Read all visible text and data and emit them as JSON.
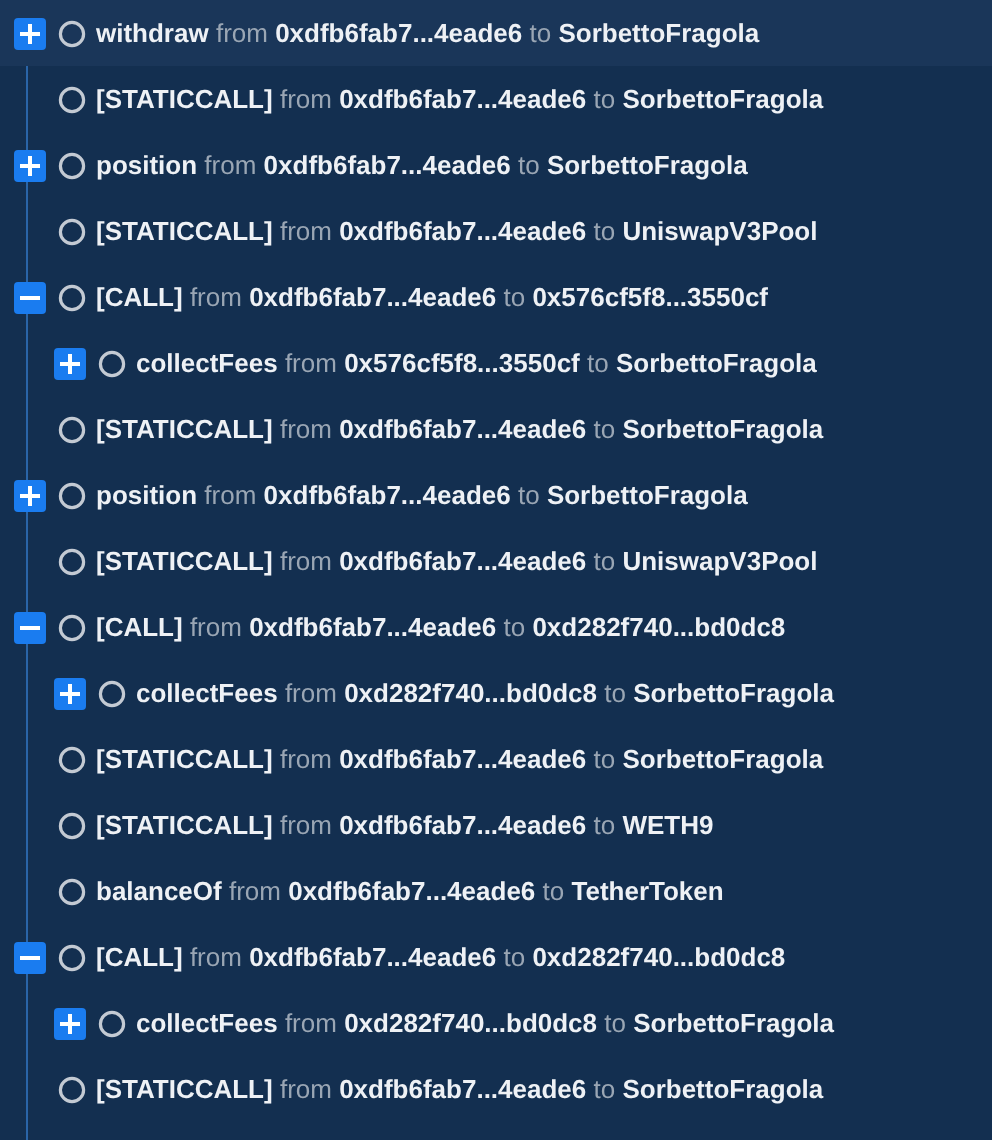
{
  "rows": [
    {
      "selected": true,
      "expanded": false,
      "parts": [
        {
          "kind": "strong",
          "text": "withdraw"
        },
        {
          "kind": "muted",
          "text": "from"
        },
        {
          "kind": "strong",
          "text": "0xdfb6fab7...4eade6"
        },
        {
          "kind": "muted",
          "text": "to"
        },
        {
          "kind": "strong",
          "text": "SorbettoFragola"
        }
      ]
    },
    {
      "selected": false,
      "parts": [
        {
          "kind": "strong",
          "text": "[STATICCALL]"
        },
        {
          "kind": "muted",
          "text": "from"
        },
        {
          "kind": "strong",
          "text": "0xdfb6fab7...4eade6"
        },
        {
          "kind": "muted",
          "text": "to"
        },
        {
          "kind": "strong",
          "text": "SorbettoFragola"
        }
      ]
    },
    {
      "selected": false,
      "expanded": false,
      "parts": [
        {
          "kind": "strong",
          "text": "position"
        },
        {
          "kind": "muted",
          "text": "from"
        },
        {
          "kind": "strong",
          "text": "0xdfb6fab7...4eade6"
        },
        {
          "kind": "muted",
          "text": "to"
        },
        {
          "kind": "strong",
          "text": "SorbettoFragola"
        }
      ]
    },
    {
      "selected": false,
      "parts": [
        {
          "kind": "strong",
          "text": "[STATICCALL]"
        },
        {
          "kind": "muted",
          "text": "from"
        },
        {
          "kind": "strong",
          "text": "0xdfb6fab7...4eade6"
        },
        {
          "kind": "muted",
          "text": "to"
        },
        {
          "kind": "strong",
          "text": "UniswapV3Pool"
        }
      ]
    },
    {
      "selected": false,
      "expanded": true,
      "parts": [
        {
          "kind": "strong",
          "text": "[CALL]"
        },
        {
          "kind": "muted",
          "text": "from"
        },
        {
          "kind": "strong",
          "text": "0xdfb6fab7...4eade6"
        },
        {
          "kind": "muted",
          "text": "to"
        },
        {
          "kind": "strong",
          "text": "0x576cf5f8...3550cf"
        }
      ],
      "children": [
        {
          "selected": false,
          "expanded": false,
          "parts": [
            {
              "kind": "strong",
              "text": "collectFees"
            },
            {
              "kind": "muted",
              "text": "from"
            },
            {
              "kind": "strong",
              "text": "0x576cf5f8...3550cf"
            },
            {
              "kind": "muted",
              "text": "to"
            },
            {
              "kind": "strong",
              "text": "SorbettoFragola"
            }
          ]
        }
      ]
    },
    {
      "selected": false,
      "parts": [
        {
          "kind": "strong",
          "text": "[STATICCALL]"
        },
        {
          "kind": "muted",
          "text": "from"
        },
        {
          "kind": "strong",
          "text": "0xdfb6fab7...4eade6"
        },
        {
          "kind": "muted",
          "text": "to"
        },
        {
          "kind": "strong",
          "text": "SorbettoFragola"
        }
      ]
    },
    {
      "selected": false,
      "expanded": false,
      "parts": [
        {
          "kind": "strong",
          "text": "position"
        },
        {
          "kind": "muted",
          "text": "from"
        },
        {
          "kind": "strong",
          "text": "0xdfb6fab7...4eade6"
        },
        {
          "kind": "muted",
          "text": "to"
        },
        {
          "kind": "strong",
          "text": "SorbettoFragola"
        }
      ]
    },
    {
      "selected": false,
      "parts": [
        {
          "kind": "strong",
          "text": "[STATICCALL]"
        },
        {
          "kind": "muted",
          "text": "from"
        },
        {
          "kind": "strong",
          "text": "0xdfb6fab7...4eade6"
        },
        {
          "kind": "muted",
          "text": "to"
        },
        {
          "kind": "strong",
          "text": "UniswapV3Pool"
        }
      ]
    },
    {
      "selected": false,
      "expanded": true,
      "parts": [
        {
          "kind": "strong",
          "text": "[CALL]"
        },
        {
          "kind": "muted",
          "text": "from"
        },
        {
          "kind": "strong",
          "text": "0xdfb6fab7...4eade6"
        },
        {
          "kind": "muted",
          "text": "to"
        },
        {
          "kind": "strong",
          "text": "0xd282f740...bd0dc8"
        }
      ],
      "children": [
        {
          "selected": false,
          "expanded": false,
          "parts": [
            {
              "kind": "strong",
              "text": "collectFees"
            },
            {
              "kind": "muted",
              "text": "from"
            },
            {
              "kind": "strong",
              "text": "0xd282f740...bd0dc8"
            },
            {
              "kind": "muted",
              "text": "to"
            },
            {
              "kind": "strong",
              "text": "SorbettoFragola"
            }
          ]
        }
      ]
    },
    {
      "selected": false,
      "parts": [
        {
          "kind": "strong",
          "text": "[STATICCALL]"
        },
        {
          "kind": "muted",
          "text": "from"
        },
        {
          "kind": "strong",
          "text": "0xdfb6fab7...4eade6"
        },
        {
          "kind": "muted",
          "text": "to"
        },
        {
          "kind": "strong",
          "text": "SorbettoFragola"
        }
      ]
    },
    {
      "selected": false,
      "parts": [
        {
          "kind": "strong",
          "text": "[STATICCALL]"
        },
        {
          "kind": "muted",
          "text": "from"
        },
        {
          "kind": "strong",
          "text": "0xdfb6fab7...4eade6"
        },
        {
          "kind": "muted",
          "text": "to"
        },
        {
          "kind": "strong",
          "text": "WETH9"
        }
      ]
    },
    {
      "selected": false,
      "parts": [
        {
          "kind": "strong",
          "text": "balanceOf"
        },
        {
          "kind": "muted",
          "text": "from"
        },
        {
          "kind": "strong",
          "text": "0xdfb6fab7...4eade6"
        },
        {
          "kind": "muted",
          "text": "to"
        },
        {
          "kind": "strong",
          "text": "TetherToken"
        }
      ]
    },
    {
      "selected": false,
      "expanded": true,
      "parts": [
        {
          "kind": "strong",
          "text": "[CALL]"
        },
        {
          "kind": "muted",
          "text": "from"
        },
        {
          "kind": "strong",
          "text": "0xdfb6fab7...4eade6"
        },
        {
          "kind": "muted",
          "text": "to"
        },
        {
          "kind": "strong",
          "text": "0xd282f740...bd0dc8"
        }
      ],
      "children": [
        {
          "selected": false,
          "expanded": false,
          "parts": [
            {
              "kind": "strong",
              "text": "collectFees"
            },
            {
              "kind": "muted",
              "text": "from"
            },
            {
              "kind": "strong",
              "text": "0xd282f740...bd0dc8"
            },
            {
              "kind": "muted",
              "text": "to"
            },
            {
              "kind": "strong",
              "text": "SorbettoFragola"
            }
          ]
        }
      ]
    },
    {
      "selected": false,
      "parts": [
        {
          "kind": "strong",
          "text": "[STATICCALL]"
        },
        {
          "kind": "muted",
          "text": "from"
        },
        {
          "kind": "strong",
          "text": "0xdfb6fab7...4eade6"
        },
        {
          "kind": "muted",
          "text": "to"
        },
        {
          "kind": "strong",
          "text": "SorbettoFragola"
        }
      ]
    }
  ]
}
